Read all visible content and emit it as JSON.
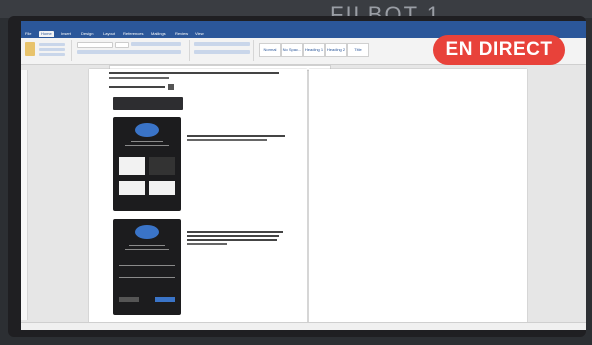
{
  "background": {
    "heading": "FILBOT 1"
  },
  "window": {
    "title": ""
  },
  "tabs": [
    "File",
    "Home",
    "Insert",
    "Design",
    "Layout",
    "References",
    "Mailings",
    "Review",
    "View"
  ],
  "ribbon": {
    "styles": [
      "Normal",
      "No Spac...",
      "Heading 1",
      "Heading 2",
      "Title"
    ]
  },
  "document": {
    "line1": "",
    "line2": "",
    "para1": "",
    "para2": ""
  },
  "live_badge": {
    "label": "EN DIRECT",
    "color": "#e8423a"
  },
  "statusbar": {
    "left": "",
    "right": ""
  },
  "colors": {
    "word_blue": "#2b579a"
  }
}
